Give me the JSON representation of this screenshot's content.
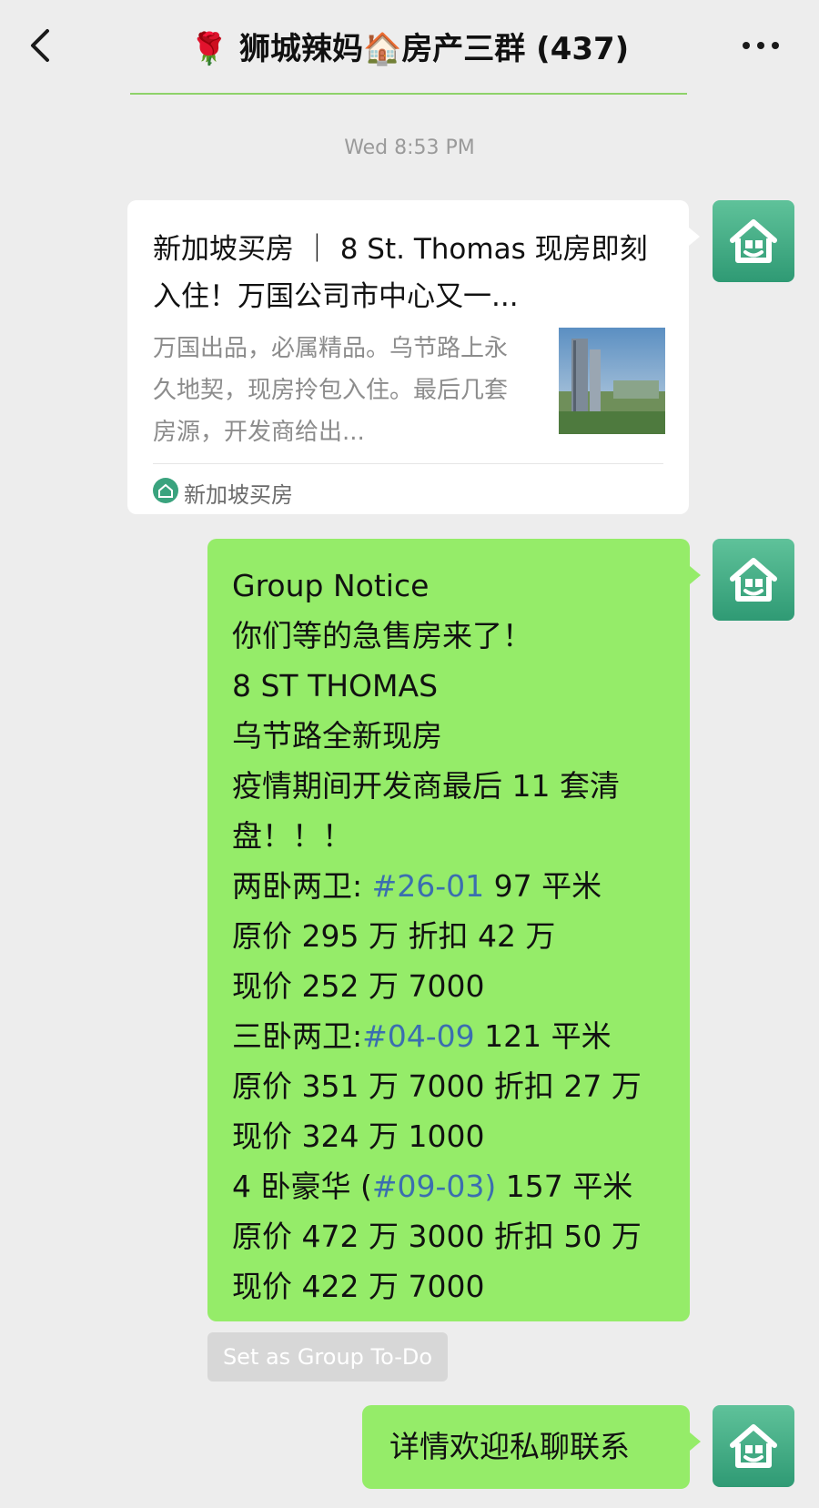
{
  "header": {
    "title_prefix_emoji": "🌹",
    "title_main": "狮城辣妈",
    "title_mid_emoji": "🏠",
    "title_suffix": "房产三群 (437)",
    "back_icon": "chevron-left-icon",
    "more_icon": "more-dots-icon"
  },
  "timestamp": "Wed 8:53 PM",
  "article_card": {
    "title": "新加坡买房 ｜ 8 St. Thomas 现房即刻入住！万国公司市中心又一...",
    "description": "万国出品，必属精品。乌节路上永久地契，现房拎包入住。最后几套房源，开发商给出...",
    "source": "新加坡买房",
    "thumbnail": "building-photo"
  },
  "notice": {
    "lines": [
      {
        "parts": [
          {
            "text": "Group Notice"
          }
        ]
      },
      {
        "parts": [
          {
            "text": "你们等的急售房来了！"
          }
        ]
      },
      {
        "parts": [
          {
            "text": "8 ST THOMAS"
          }
        ]
      },
      {
        "parts": [
          {
            "text": "乌节路全新现房"
          }
        ]
      },
      {
        "parts": [
          {
            "text": "疫情期间开发商最后 11 套清"
          }
        ]
      },
      {
        "parts": [
          {
            "text": "盘！！！"
          }
        ]
      },
      {
        "parts": [
          {
            "text": "两卧两卫: "
          },
          {
            "text": "#26-01",
            "link": true
          },
          {
            "text": " 97 平米"
          }
        ]
      },
      {
        "parts": [
          {
            "text": "原价 295 万 折扣 42 万"
          }
        ]
      },
      {
        "parts": [
          {
            "text": "现价 252 万 7000"
          }
        ]
      },
      {
        "parts": [
          {
            "text": "三卧两卫:"
          },
          {
            "text": "#04-09",
            "link": true
          },
          {
            "text": "  121 平米"
          }
        ]
      },
      {
        "parts": [
          {
            "text": "原价 351 万 7000 折扣 27 万"
          }
        ]
      },
      {
        "parts": [
          {
            "text": "现价 324 万 1000"
          }
        ]
      },
      {
        "parts": [
          {
            "text": "4 卧豪华 ("
          },
          {
            "text": "#09-03)",
            "link": true
          },
          {
            "text": " 157 平米"
          }
        ]
      },
      {
        "parts": [
          {
            "text": "原价 472 万 3000 折扣 50 万"
          }
        ]
      },
      {
        "parts": [
          {
            "text": "现价 422 万 7000"
          }
        ]
      }
    ]
  },
  "todo_button": "Set as Group To-Do",
  "reply_message": "详情欢迎私聊联系",
  "colors": {
    "background": "#ededed",
    "bubble_green": "#95ec69",
    "link_blue": "#3b6eb0",
    "avatar_green": "#3aa37e"
  }
}
